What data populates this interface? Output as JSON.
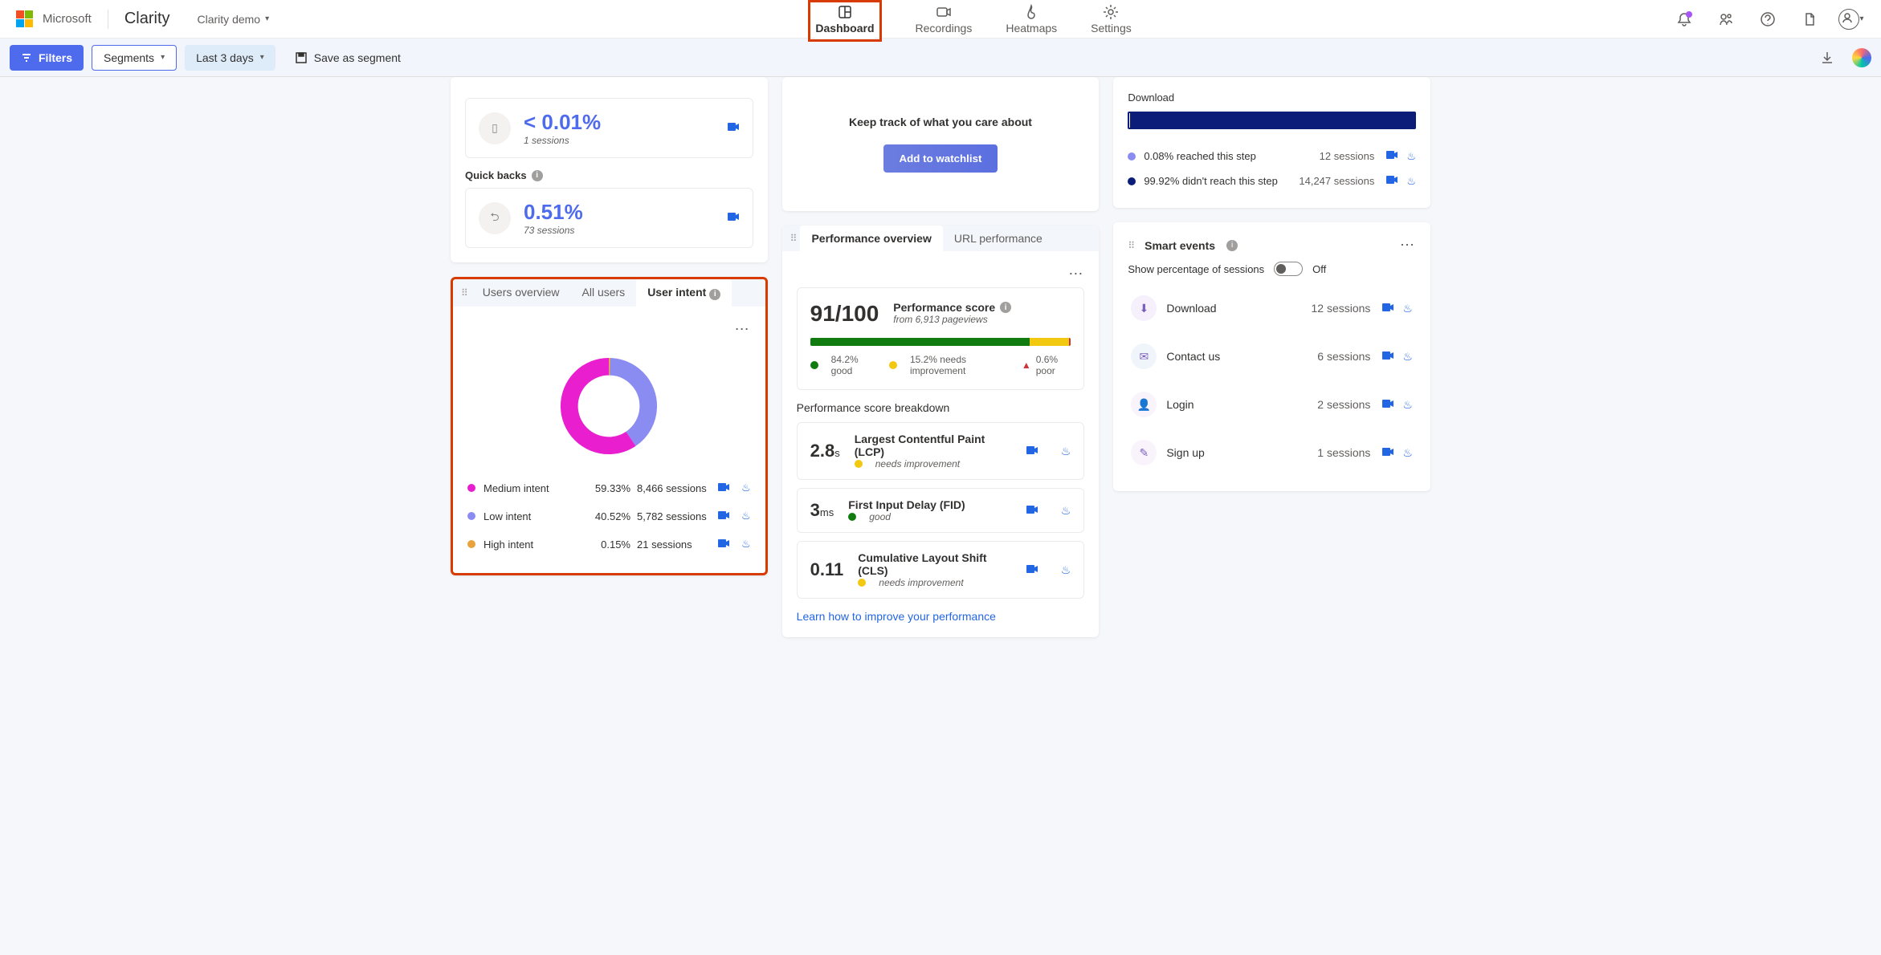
{
  "header": {
    "ms_text": "Microsoft",
    "product": "Clarity",
    "project": "Clarity demo",
    "tabs": [
      "Dashboard",
      "Recordings",
      "Heatmaps",
      "Settings"
    ]
  },
  "filters": {
    "filters_btn": "Filters",
    "segments_btn": "Segments",
    "date_btn": "Last 3 days",
    "save_btn": "Save as segment"
  },
  "top_card": {
    "val1": "< 0.01%",
    "sub1": "1 sessions",
    "quick_backs_label": "Quick backs",
    "val2": "0.51%",
    "sub2": "73 sessions"
  },
  "watchlist": {
    "text": "Keep track of what you care about",
    "btn": "Add to watchlist"
  },
  "download": {
    "title": "Download",
    "r1_pct": "0.08% reached this step",
    "r1_sessions": "12 sessions",
    "r2_pct": "99.92% didn't reach this step",
    "r2_sessions": "14,247 sessions"
  },
  "users": {
    "tabs": [
      "Users overview",
      "All users",
      "User intent"
    ],
    "legend1": "Medium intent",
    "p1": "59.33%",
    "c1": "8,466 sessions",
    "legend2": "Low intent",
    "p2": "40.52%",
    "c2": "5,782 sessions",
    "legend3": "High intent",
    "p3": "0.15%",
    "c3": "21 sessions"
  },
  "chart_data": {
    "type": "pie",
    "title": "User intent",
    "series": [
      {
        "name": "Medium intent",
        "value": 59.33,
        "color": "#e91ecf"
      },
      {
        "name": "Low intent",
        "value": 40.52,
        "color": "#8b8cf2"
      },
      {
        "name": "High intent",
        "value": 0.15,
        "color": "#e8a33d"
      }
    ]
  },
  "perf": {
    "tabs": [
      "Performance overview",
      "URL performance"
    ],
    "score": "91/100",
    "score_label": "Performance score",
    "pageviews": "from 6,913 pageviews",
    "good": "84.2% good",
    "needs": "15.2% needs improvement",
    "poor": "0.6% poor",
    "breakdown_title": "Performance score breakdown",
    "lcp_val": "2.8",
    "lcp_unit": "s",
    "lcp_title": "Largest Contentful Paint (LCP)",
    "lcp_status": "needs improvement",
    "fid_val": "3",
    "fid_unit": "ms",
    "fid_title": "First Input Delay (FID)",
    "fid_status": "good",
    "cls_val": "0.11",
    "cls_unit": "",
    "cls_title": "Cumulative Layout Shift (CLS)",
    "cls_status": "needs improvement",
    "learn": "Learn how to improve your performance"
  },
  "smart": {
    "title": "Smart events",
    "toggle_label": "Show percentage of sessions",
    "toggle_state": "Off",
    "rows": [
      {
        "icon": "⬇",
        "name": "Download",
        "sessions": "12 sessions",
        "color": "#d9c2f0"
      },
      {
        "icon": "✉",
        "name": "Contact us",
        "sessions": "6 sessions",
        "color": "#c2d4f0"
      },
      {
        "icon": "👤",
        "name": "Login",
        "sessions": "2 sessions",
        "color": "#e9d5f2"
      },
      {
        "icon": "✎",
        "name": "Sign up",
        "sessions": "1 sessions",
        "color": "#e9d5f2"
      }
    ]
  }
}
